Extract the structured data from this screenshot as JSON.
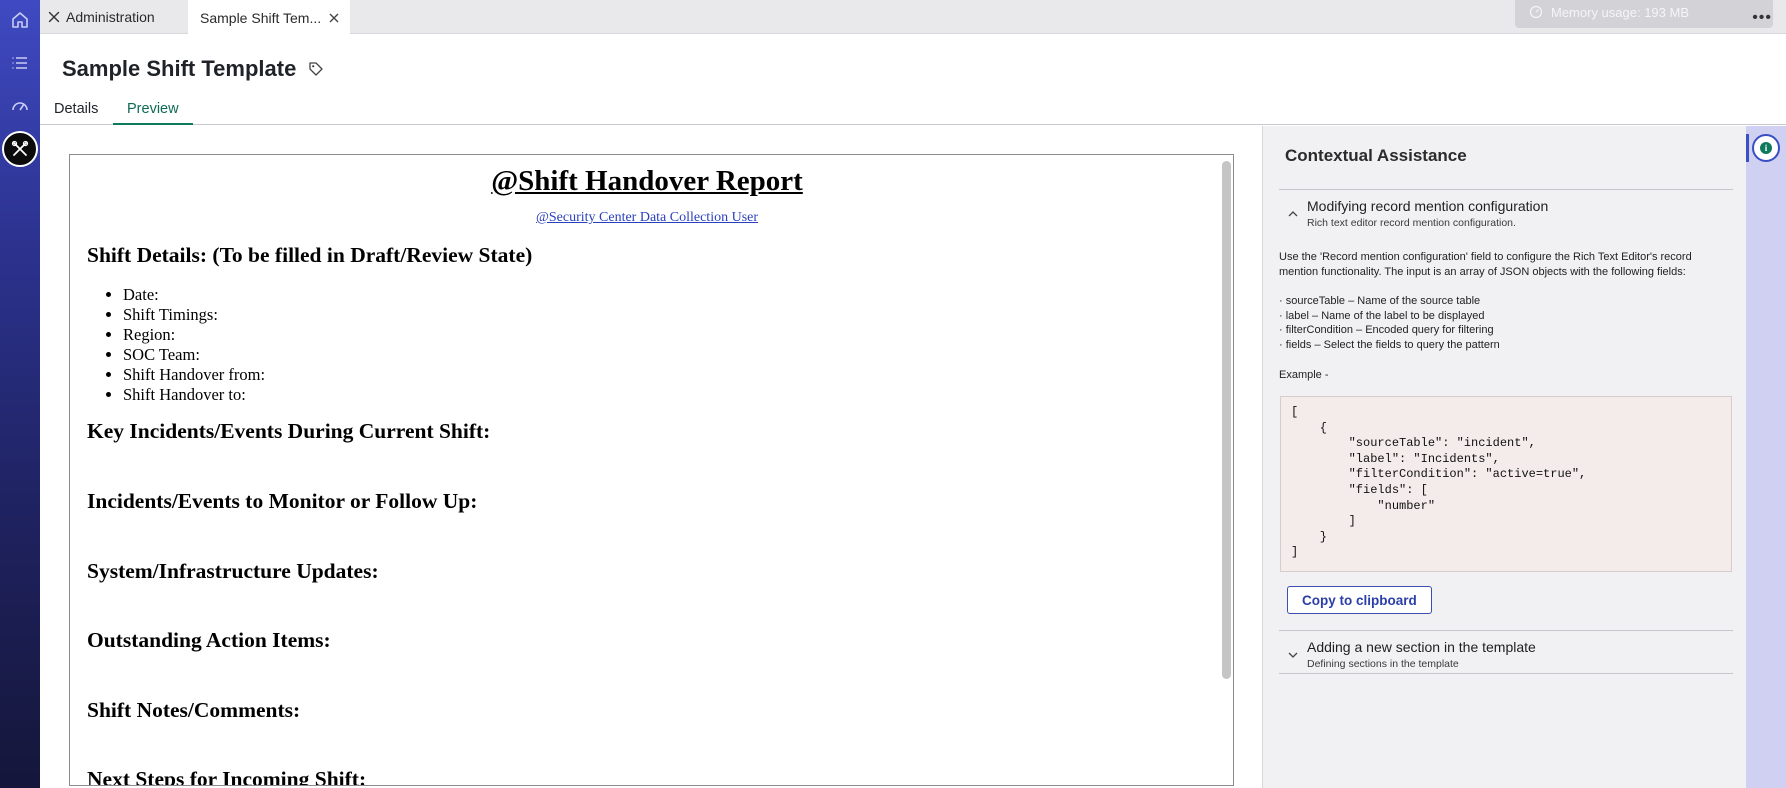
{
  "top_tabs": {
    "admin_label": "Administration",
    "sample_label": "Sample Shift Tem..."
  },
  "memory": {
    "label": "Memory usage: 193 MB"
  },
  "page": {
    "title": "Sample Shift Template"
  },
  "page_tabs": {
    "details": "Details",
    "preview": "Preview"
  },
  "document": {
    "title": "@Shift Handover Report",
    "subtitle": "@Security Center Data Collection User",
    "shift_details_heading": "Shift Details: (To be filled in Draft/Review State)",
    "shift_items": [
      "Date:",
      "Shift Timings:",
      "Region:",
      "SOC Team:",
      "Shift Handover from:",
      "Shift Handover to:"
    ],
    "headings": [
      "Key Incidents/Events During Current Shift:",
      "Incidents/Events to Monitor or Follow Up:",
      "System/Infrastructure Updates:",
      "Outstanding Action Items:",
      "Shift Notes/Comments:",
      "Next Steps for Incoming Shift:"
    ]
  },
  "assist": {
    "title": "Contextual Assistance",
    "section1": {
      "name": "Modifying record mention configuration",
      "sub": "Rich text editor record mention configuration."
    },
    "intro": "Use the 'Record mention configuration' field to configure the Rich Text Editor's record mention functionality. The input is an array of JSON objects with the following fields:",
    "fields": [
      "· sourceTable – Name of the source table",
      "· label – Name of the label to be displayed",
      "· filterCondition – Encoded query for filtering",
      "· fields – Select the fields to query the pattern"
    ],
    "example_label": "Example -",
    "code": "[\n    {\n        \"sourceTable\": \"incident\",\n        \"label\": \"Incidents\",\n        \"filterCondition\": \"active=true\",\n        \"fields\": [\n            \"number\"\n        ]\n    }\n]",
    "copy_button": "Copy to clipboard",
    "section2": {
      "name": "Adding a new section in the template",
      "sub": "Defining sections in the template"
    }
  },
  "colors": {
    "accent_green": "#0e7a5c",
    "brand_blue": "#3a4fc2",
    "link_blue": "#2a3fbf"
  }
}
